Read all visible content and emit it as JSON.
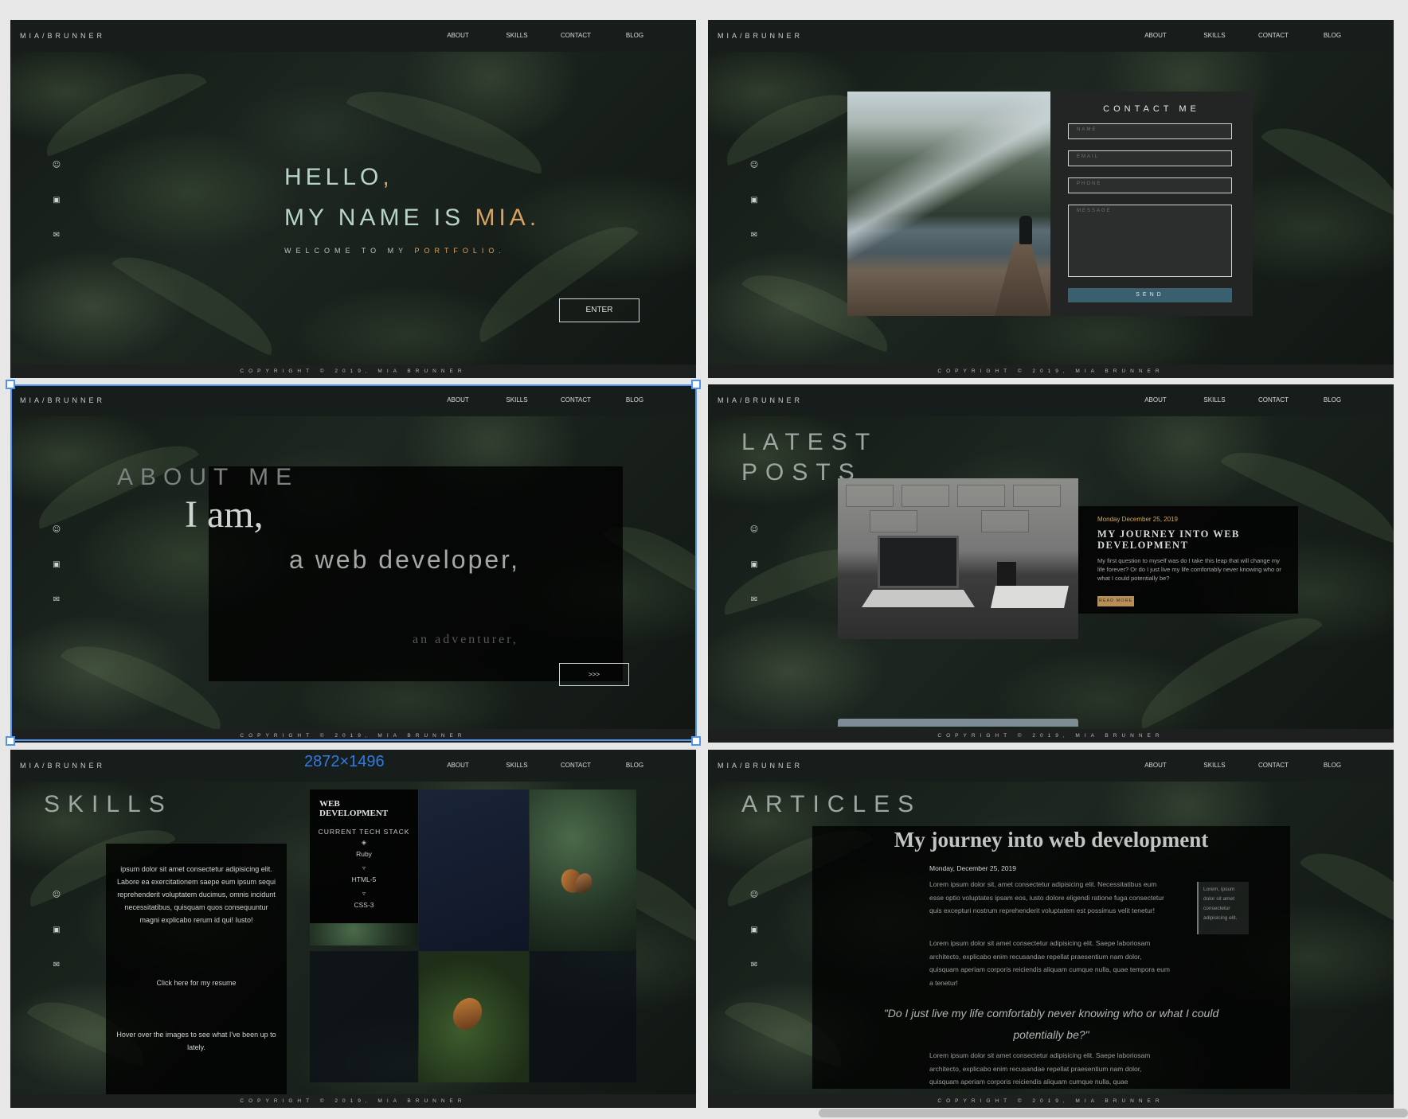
{
  "site": {
    "logo": "MIA/BRUNNER",
    "nav": [
      "ABOUT",
      "SKILLS",
      "CONTACT",
      "BLOG"
    ],
    "footer": "COPYRIGHT © 2019, MIA BRUNNER",
    "social_icons": [
      "github-icon",
      "linkedin-icon",
      "mail-icon"
    ]
  },
  "hero": {
    "hello": "HELLO",
    "hello_comma": ",",
    "name_prefix": "MY NAME IS ",
    "name": "MIA.",
    "welcome_prefix": "WELCOME TO MY ",
    "welcome_accent": "PORTFOLIO.",
    "enter_label": "ENTER",
    "accent_color": "#d8a362"
  },
  "contact": {
    "title": "CONTACT ME",
    "name_placeholder": "NAME",
    "email_placeholder": "EMAIL",
    "phone_placeholder": "PHONE",
    "message_placeholder": "MESSAGE",
    "send_label": "SEND",
    "button_color": "#3a5f6e"
  },
  "about": {
    "title": "ABOUT ME",
    "line1": "I am,",
    "line2": "a web developer,",
    "line3": "an adventurer,",
    "next_label": ">>>"
  },
  "posts": {
    "title_line1": "LATEST",
    "title_line2": "POSTS",
    "date": "Monday December 25, 2019",
    "heading": "MY JOURNEY INTO WEB DEVELOPMENT",
    "excerpt": "My first question to myself was do I take this leap that will change my life forever? Or do I just live my life comfortably never knowing who or what I could potentially be?",
    "read_more": "READ MORE"
  },
  "skills": {
    "title": "SKILLS",
    "intro": "ipsum dolor sit amet consectetur adipisicing elit. Labore ea exercitationem saepe eum ipsum sequi reprehenderit voluptatem ducimus, omnis incidunt necessitatibus, quisquam quos consequuntur magni explicabo rerum id qui! Iusto!",
    "resume_link": "Click here for my resume",
    "hover_note": "Hover over the images to see what I've been up to lately.",
    "stack_title_line1": "WEB",
    "stack_title_line2": "DEVELOPMENT",
    "stack_subtitle": "CURRENT TECH STACK",
    "stack": [
      "Ruby",
      "HTML-5",
      "CSS-3"
    ]
  },
  "articles": {
    "title": "ARTICLES",
    "heading": "My journey into web development",
    "date": "Monday, December 25, 2019",
    "para1": "Lorem ipsum dolor sit, amet consectetur adipisicing elit. Necessitatibus eum esse optio voluptates ipsam eos, iusto dolore eligendi ratione fuga consectetur quis excepturi nostrum reprehenderit voluptatem est possimus velit tenetur!",
    "para2": "Lorem ipsum dolor sit amet consectetur adipisicing elit. Saepe laboriosam architecto, explicabo enim recusandae repellat praesentium nam dolor, quisquam aperiam corporis reiciendis aliquam cumque nulla, quae tempora eum a tenetur!",
    "side_quote": "Lorem, ipsum dolor sit amet consectetur adipisicing elit.",
    "quote": "\"Do I just live my life comfortably never knowing who or what I could potentially be?\"",
    "para3": "Lorem ipsum dolor sit amet consectetur adipisicing elit. Saepe laboriosam architecto, explicabo enim recusandae repellat praesentium nam dolor, quisquam aperiam corporis reiciendis aliquam cumque nulla, quae"
  },
  "canvas": {
    "dimension_label": "2872×1496",
    "selection_color": "#4d94f0"
  }
}
